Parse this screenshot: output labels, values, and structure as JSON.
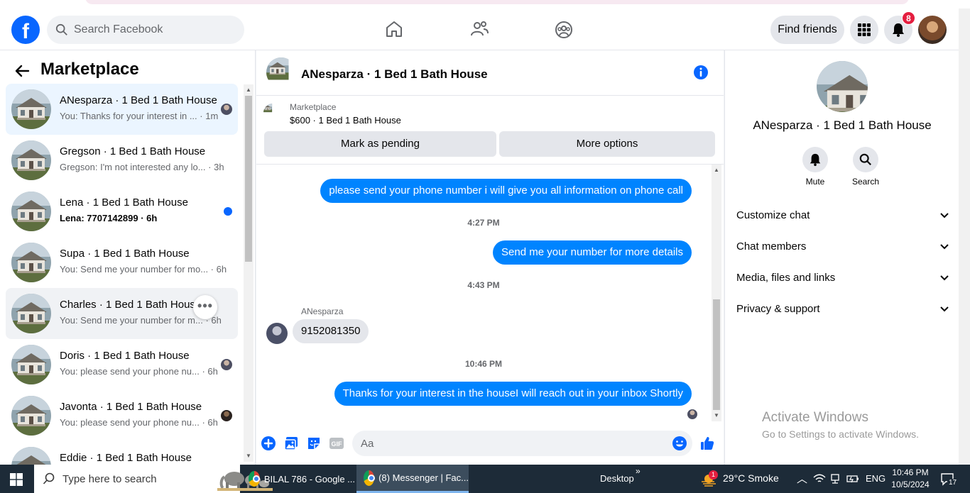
{
  "browser": {},
  "topnav": {
    "logo_letter": "f",
    "search_placeholder": "Search Facebook",
    "find_friends_label": "Find friends",
    "notifications_count": "8"
  },
  "marketplace": {
    "title": "Marketplace",
    "conversations": [
      {
        "name": "ANesparza · 1 Bed 1 Bath House",
        "preview": "You: Thanks for your interest in ... · 1m"
      },
      {
        "name": "Gregson · 1 Bed 1 Bath House",
        "preview": "Gregson: I'm not interested any lo... · 3h"
      },
      {
        "name": "Lena · 1 Bed 1 Bath House",
        "preview": "Lena: 7707142899 · 6h"
      },
      {
        "name": "Supa · 1 Bed 1 Bath House",
        "preview": "You: Send me your number for mo... · 6h"
      },
      {
        "name": "Charles · 1 Bed 1 Bath House",
        "preview": "You: Send me your number for m... · 6h"
      },
      {
        "name": "Doris · 1 Bed 1 Bath House",
        "preview": "You: please send your phone nu... · 6h"
      },
      {
        "name": "Javonta · 1 Bed 1 Bath House",
        "preview": "You: please send your phone nu... · 6h"
      },
      {
        "name": "Eddie · 1 Bed 1 Bath House",
        "preview": ""
      }
    ]
  },
  "chat": {
    "title": "ANesparza · 1 Bed 1 Bath House",
    "listing_label": "Marketplace",
    "listing_price": "$600 · 1 Bed 1 Bath House",
    "mark_pending_label": "Mark as pending",
    "more_options_label": "More options",
    "messages": [
      {
        "text": "please send your phone number i will give you all information on phone call"
      },
      {
        "timestamp": "4:27 PM"
      },
      {
        "text": "Send me your number for more details"
      },
      {
        "timestamp": "4:43 PM"
      },
      {
        "sender": "ANesparza",
        "text": "9152081350"
      },
      {
        "timestamp": "10:46 PM"
      },
      {
        "text": "Thanks for your interest in the houseI will reach out in your inbox Shortly"
      }
    ],
    "composer_placeholder": "Aa"
  },
  "info_panel": {
    "name": "ANesparza · 1 Bed 1 Bath House",
    "mute_label": "Mute",
    "search_label": "Search",
    "sections": [
      "Customize chat",
      "Chat members",
      "Media, files and links",
      "Privacy & support"
    ]
  },
  "watermark": {
    "line1": "Activate Windows",
    "line2": "Go to Settings to activate Windows."
  },
  "taskbar": {
    "search_placeholder": "Type here to search",
    "apps": [
      "BILAL 786 - Google ...",
      "(8) Messenger | Fac..."
    ],
    "desktop_label": "Desktop",
    "weather_badge": "1",
    "weather": "29°C  Smoke",
    "language": "ENG",
    "time": "10:46 PM",
    "date": "10/5/2024",
    "notification_count": "17"
  },
  "colors": {
    "accent": "#0866ff",
    "bubble_out": "#0084ff",
    "badge": "#e41e3f"
  }
}
